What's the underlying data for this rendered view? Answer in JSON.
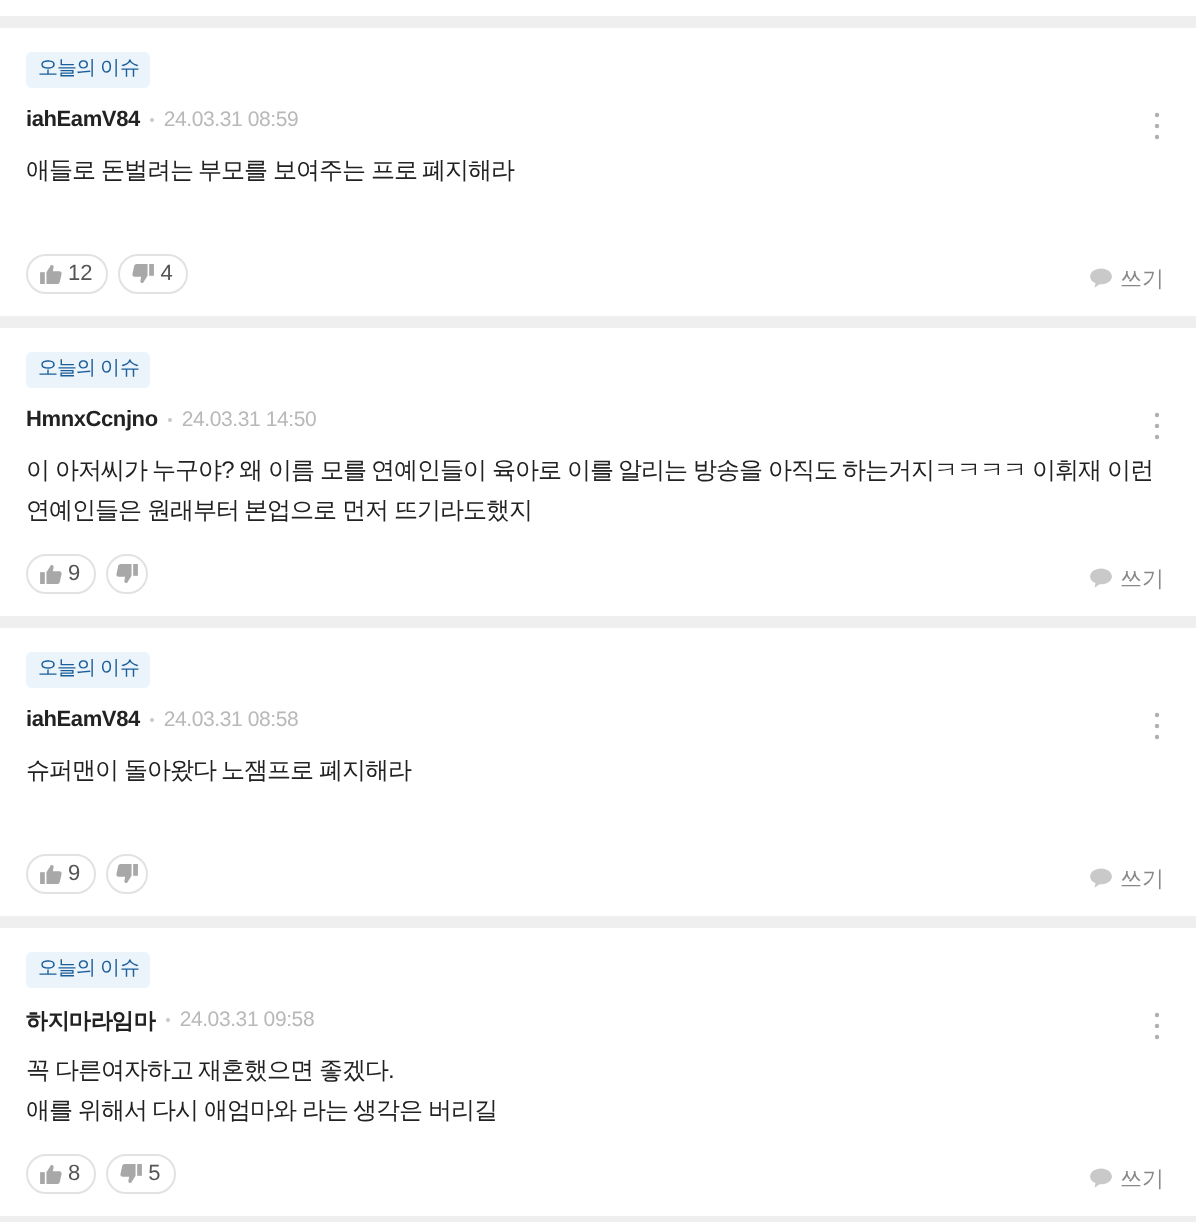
{
  "comments": [
    {
      "tag": "오늘의 이슈",
      "author": "iahEamV84",
      "date": "24.03.31 08:59",
      "text": "애들로 돈벌려는 부모를 보여주는 프로 폐지해라",
      "likes": "12",
      "dislikes": "4",
      "reply_label": "쓰기"
    },
    {
      "tag": "오늘의 이슈",
      "author": "HmnxCcnjno",
      "date": "24.03.31 14:50",
      "text": "이 아저씨가 누구야? 왜 이름 모를 연예인들이 육아로 이를 알리는 방송을 아직도 하는거지ㅋㅋㅋㅋ  이휘재 이런 연예인들은 원래부터 본업으로 먼저 뜨기라도했지",
      "likes": "9",
      "reply_label": "쓰기"
    },
    {
      "tag": "오늘의 이슈",
      "author": "iahEamV84",
      "date": "24.03.31 08:58",
      "text": "슈퍼맨이 돌아왔다 노잼프로 폐지해라",
      "likes": "9",
      "reply_label": "쓰기"
    },
    {
      "tag": "오늘의 이슈",
      "author": "하지마라임마",
      "date": "24.03.31 09:58",
      "text": "꼭 다른여자하고 재혼했으면 좋겠다.\n애를 위해서 다시 애엄마와 라는 생각은 버리길",
      "likes": "8",
      "dislikes": "5",
      "reply_label": "쓰기"
    }
  ]
}
